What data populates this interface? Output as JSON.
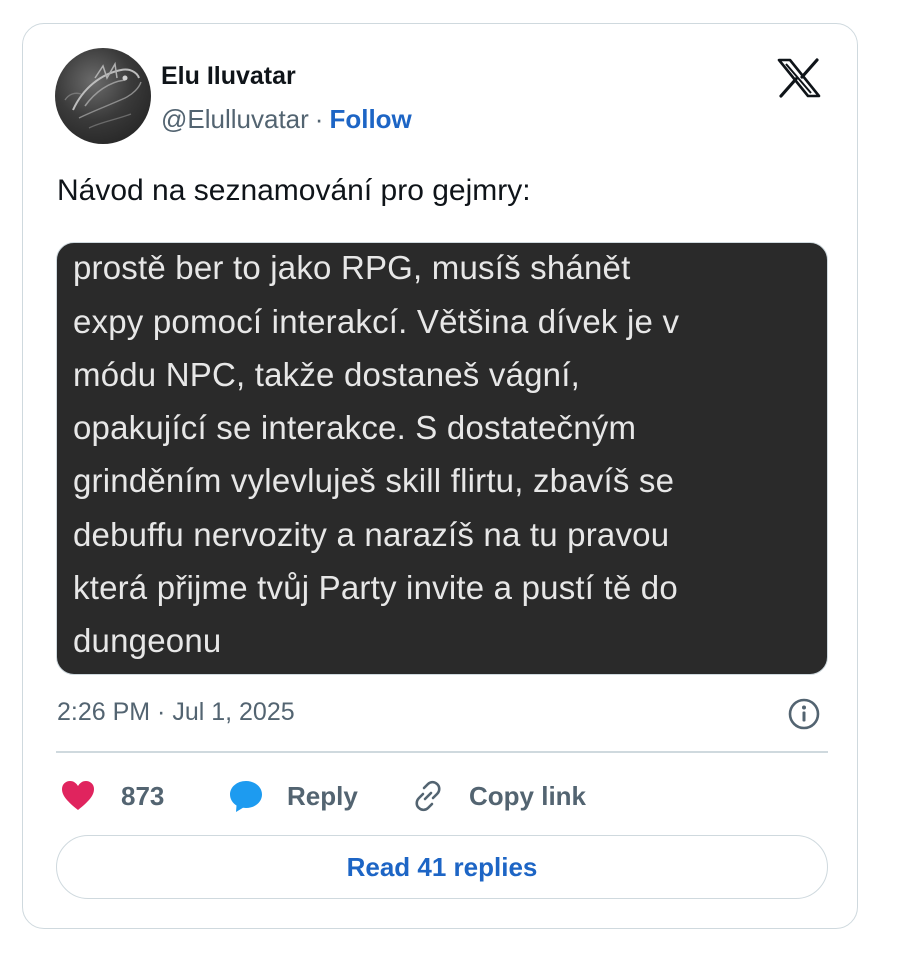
{
  "colors": {
    "accent": "#1d65c5",
    "like": "#e0245e",
    "reply": "#1d9bf0",
    "muted": "#536471",
    "text": "#0f1419",
    "media_bg": "#2a2a2a"
  },
  "author": {
    "name": "Elu Iluvatar",
    "handle": "@Elulluvatar",
    "separator": "·",
    "follow_label": "Follow",
    "avatar_icon": "avatar-dragon-sketch"
  },
  "platform_icon": "x-logo-icon",
  "tweet": {
    "text": "Návod na seznamování pro gejmry:",
    "media_lines": [
      "prostě ber to jako RPG, musíš shánět",
      "expy pomocí interakcí. Většina dívek je v",
      "módu NPC, takže dostaneš vágní,",
      "opakující se interakce. S dostatečným",
      "grinděním vylevluješ skill flirtu, zbavíš se",
      "debuffu nervozity a narazíš na tu pravou",
      "která přijme tvůj Party invite a pustí tě do",
      "dungeonu"
    ],
    "timestamp": "2:26 PM · Jul 1, 2025"
  },
  "actions": {
    "like_count": "873",
    "reply_label": "Reply",
    "copy_label": "Copy link"
  },
  "footer": {
    "read_replies_label": "Read 41 replies"
  }
}
